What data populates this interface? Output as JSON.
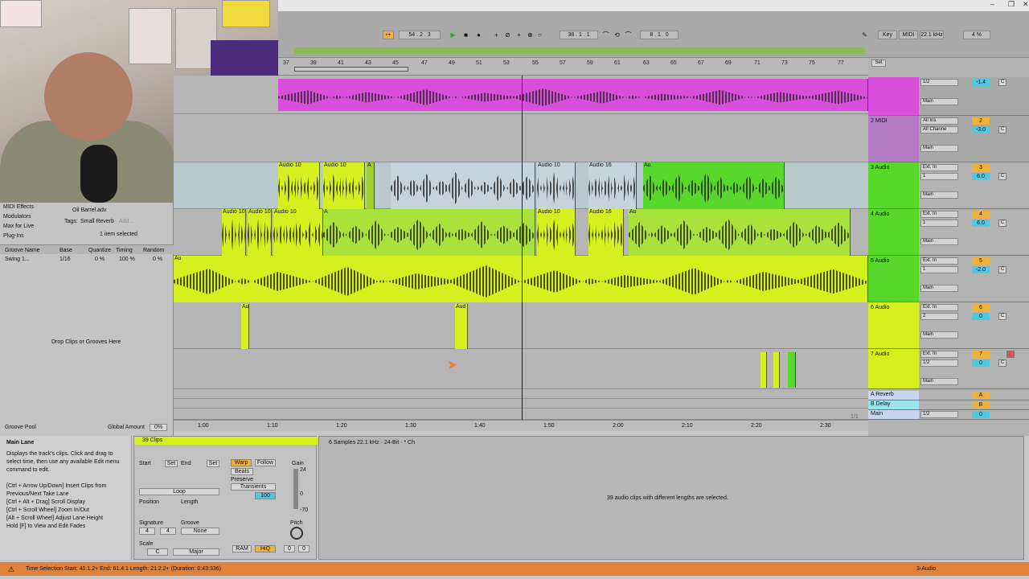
{
  "transport": {
    "arrangement_pos": "54 .  2 .  3",
    "loop_start": "38 .  1 .  1",
    "loop_length": "8 .  1 .  0",
    "key_label": "Key",
    "midi_label": "MIDI",
    "sample_rate": "22.1 kHz",
    "cpu": "4 %"
  },
  "ruler": {
    "bars": [
      "37",
      "39",
      "41",
      "43",
      "45",
      "47",
      "49",
      "51",
      "53",
      "55",
      "57",
      "59",
      "61",
      "63",
      "65",
      "67",
      "69",
      "71",
      "73",
      "75",
      "77"
    ],
    "set_label": "Set"
  },
  "browser": {
    "items": [
      "MIDI Effects",
      "Modulators",
      "Max for Live",
      "Plug-Ins"
    ],
    "file": "Oil Barrel.adv",
    "tags_label": "Tags:",
    "tag_value": "Small Reverb",
    "tag_add": "Add...",
    "selected": "1 item selected",
    "groove_headers": [
      "Groove Name",
      "Base",
      "Quantize",
      "Timing",
      "Random"
    ],
    "groove_row": {
      "name": "Swing 1...",
      "base": "1/16",
      "quantize": "0 %",
      "timing": "100 %",
      "random": "0 %"
    },
    "drop_hint": "Drop Clips or Grooves Here",
    "groove_pool": "Groove Pool",
    "global_amount_label": "Global Amount",
    "global_amount": "0%"
  },
  "tracks": [
    {
      "name": "",
      "color": "#d94fdc",
      "input": "1/2",
      "vol": "-1.4",
      "pan": "C",
      "out": "Main",
      "num": ""
    },
    {
      "name": "2 MIDI",
      "color": "#b57cc6",
      "input": "All Ins",
      "input2": "All Channe",
      "vol": "-3.0",
      "pan": "C",
      "out": "Main",
      "num": "2"
    },
    {
      "name": "3 Audio",
      "color": "#57d82b",
      "input": "Ext. In",
      "input2": "1",
      "vol": "6.0",
      "pan": "C",
      "out": "Main",
      "num": "3"
    },
    {
      "name": "4 Audio",
      "color": "#57d82b",
      "input": "Ext. In",
      "input2": "1",
      "vol": "6.0",
      "pan": "C",
      "out": "Main",
      "num": "4"
    },
    {
      "name": "5 Audio",
      "color": "#57d82b",
      "input": "Ext. In",
      "input2": "1",
      "vol": "-2.0",
      "pan": "C",
      "out": "Main",
      "num": "5"
    },
    {
      "name": "6 Audio",
      "color": "#d4f01e",
      "input": "Ext. In",
      "input2": "2",
      "vol": "0",
      "pan": "C",
      "out": "Main",
      "num": "6"
    },
    {
      "name": "7 Audio",
      "color": "#d4f01e",
      "input": "Ext. In",
      "input2": "1/2",
      "vol": "0",
      "pan": "C",
      "out": "Main",
      "num": "7"
    }
  ],
  "returns": [
    {
      "name": "A Reverb",
      "letter": "A",
      "color": "#5c86d8"
    },
    {
      "name": "B Delay",
      "letter": "B",
      "color": "#5cc4d8"
    },
    {
      "name": "Main",
      "letter": "",
      "color": "#5c86d8",
      "input": "1/2",
      "vol": "0"
    }
  ],
  "clip_labels": {
    "audio10": "Audio 10",
    "audio16": "Audio 16",
    "au": "Au",
    "aud": "Aud",
    "a": "A"
  },
  "timeline": [
    "1:00",
    "1:10",
    "1:20",
    "1:30",
    "1:40",
    "1:50",
    "2:00",
    "2:10",
    "2:20",
    "2:30"
  ],
  "mixer_ratio": "1/1",
  "info": {
    "title": "Main Lane",
    "body": "Displays the track's clips. Click and drag to select time, then use any available Edit menu command to edit.",
    "shortcuts": [
      "[Ctrl + Arrow Up/Down] Insert Clips from Previous/Next Take Lane",
      "[Ctrl + Alt + Drag] Scroll Display",
      "[Ctrl + Scroll Wheel] Zoom In/Out",
      "[Alt + Scroll Wheel] Adjust Lane Height",
      "Hold [F] to View and Edit Fades"
    ]
  },
  "clip": {
    "title": "39 Clips",
    "start_label": "Start",
    "end_label": "End",
    "set_label": "Set",
    "loop_label": "Loop",
    "position_label": "Position",
    "length_label": "Length",
    "signature_label": "Signature",
    "sig_num": "4",
    "sig_den": "4",
    "groove_label": "Groove",
    "groove_value": "None",
    "scale_label": "Scale",
    "scale_root": "C",
    "scale_name": "Major",
    "warp_label": "Warp",
    "follow_label": "Follow",
    "beats_label": "Beats",
    "preserve_label": "Preserve",
    "transients_label": "Transients",
    "rate": "100",
    "gain_label": "Gain",
    "gain_top": "24",
    "gain_mid": "0",
    "gain_bot": "-70",
    "pitch_label": "Pitch",
    "ram_label": "RAM",
    "hiq_label": "HiQ",
    "pitch_st": "0",
    "pitch_ct": "0"
  },
  "sample": {
    "header": "6 Samples  22.1 kHz · 24-Bit · * Ch",
    "message": "39 audio clips with different lengths are selected."
  },
  "status": {
    "text": "Time Selection   Start: 40.1.2+   End: 61.4.1   Length: 21.2.2+ (Duration: 0:43:336)",
    "track": "3-Audio"
  }
}
